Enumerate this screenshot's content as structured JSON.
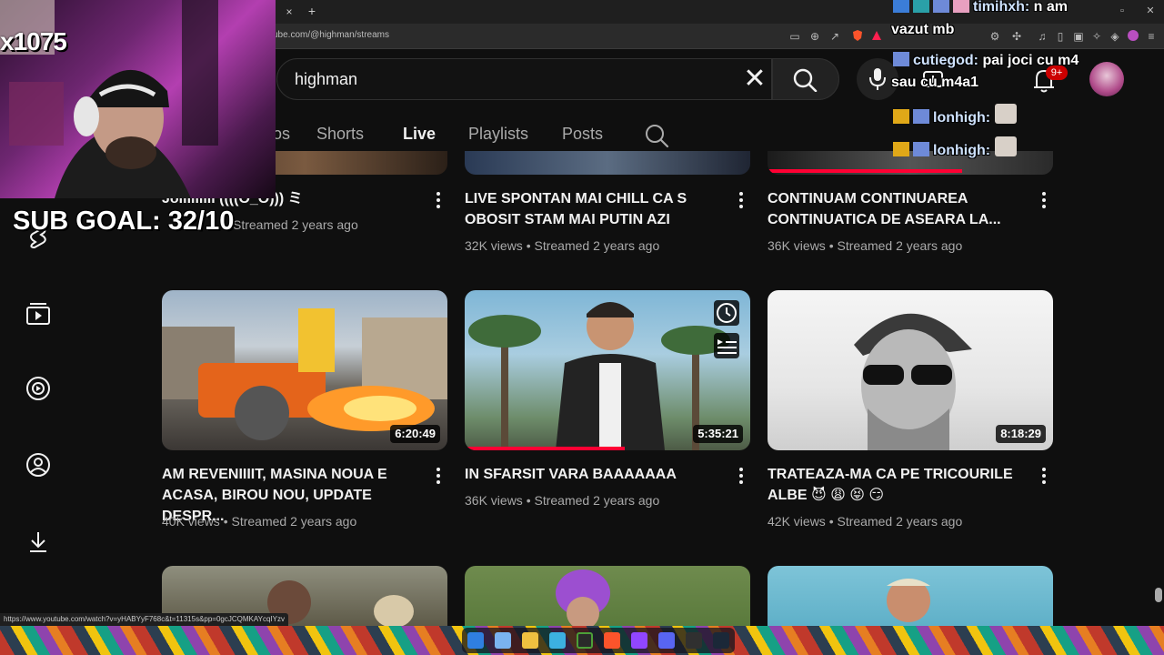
{
  "browser": {
    "url": "ube.com/@highman/streams",
    "status_url": "https://www.youtube.com/watch?v=yHABYyF768c&t=11315s&pp=0gcJCQMKAYcqIYzv",
    "tab_close": "×",
    "tab_new": "+"
  },
  "search": {
    "query": "highman",
    "clear": "✕"
  },
  "notifications": {
    "count": "9+"
  },
  "tabs": [
    {
      "label": "os"
    },
    {
      "label": "Shorts"
    },
    {
      "label": "Live"
    },
    {
      "label": "Playlists"
    },
    {
      "label": "Posts"
    }
  ],
  "videos_row1": [
    {
      "title": "Jolllllllll ((((O_O))) ミ",
      "meta": "Streamed 2 years ago",
      "views": ""
    },
    {
      "title": "LIVE SPONTAN MAI CHILL CA S OBOSIT STAM MAI PUTIN AZI",
      "views": "32K views",
      "streamed": "Streamed 2 years ago"
    },
    {
      "title": "CONTINUAM CONTINUAREA CONTINUATICA DE ASEARA LA...",
      "views": "36K views",
      "streamed": "Streamed 2 years ago"
    }
  ],
  "videos_row2": [
    {
      "title": "AM REVENIIIIT, MASINA NOUA E ACASA, BIROU NOU, UPDATE DESPR...",
      "views": "40K views",
      "streamed": "Streamed 2 years ago",
      "duration": "6:20:49",
      "progress": 0
    },
    {
      "title": "IN SFARSIT VARA BAAAAAAA",
      "views": "36K views",
      "streamed": "Streamed 2 years ago",
      "duration": "5:35:21",
      "progress": 0.56
    },
    {
      "title": "TRATEAZA-MA CA PE TRICOURILE ALBE 😈 😩 😝 😏",
      "views": "42K views",
      "streamed": "Streamed 2 years ago",
      "duration": "8:18:29",
      "progress": 0
    }
  ],
  "row1_progress": [
    0,
    0,
    0.68
  ],
  "overlay": {
    "cam_count": "x1075",
    "sub_goal": "SUB GOAL: 32/10",
    "chat": [
      {
        "user": "timihxh:",
        "text": "n am"
      },
      {
        "user": "",
        "text": "vazut mb"
      },
      {
        "user": "cutiegod:",
        "text": "pai joci cu m4"
      },
      {
        "user": "",
        "text": "sau cu m4a1"
      },
      {
        "user": "lonhigh:",
        "text": ""
      },
      {
        "user": "lonhigh:",
        "text": ""
      }
    ]
  },
  "colors": {
    "youtube_red": "#ff0033",
    "background": "#0f0f0f",
    "text_secondary": "#aaaaaa"
  }
}
